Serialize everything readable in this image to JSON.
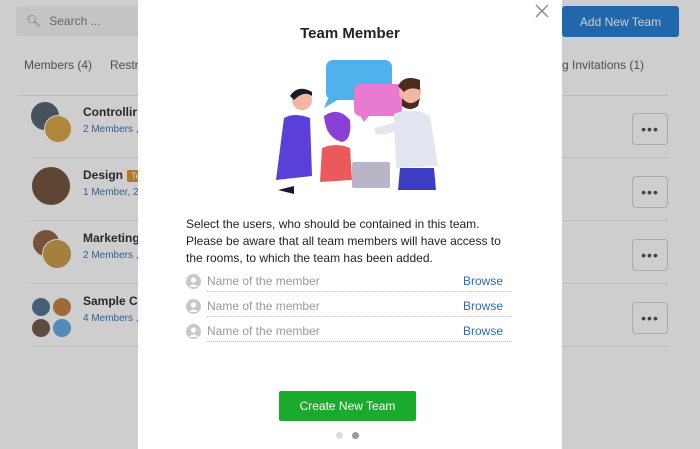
{
  "search": {
    "placeholder": "Search ..."
  },
  "header": {
    "add_team_label": "Add New Team"
  },
  "tabs": {
    "members": "Members (4)",
    "restricted": "Restr",
    "invitations": "g Invitations (1)"
  },
  "teams": [
    {
      "name": "Controllir",
      "meta": "2 Members ,",
      "tag": ""
    },
    {
      "name": "Design",
      "meta": "1 Member, 2",
      "tag": "Te"
    },
    {
      "name": "Marketing",
      "meta": "2 Members ,",
      "tag": ""
    },
    {
      "name": "Sample Co",
      "meta": "4 Members ,",
      "tag": ""
    }
  ],
  "modal": {
    "title": "Team Member",
    "description": "Select the users, who should be contained in this team. Please be aware that all team members will have access to the rooms, to which the team has been added.",
    "member_placeholder": "Name of the member",
    "browse_label": "Browse",
    "create_label": "Create New Team",
    "pager": {
      "total": 2,
      "active": 2
    }
  },
  "colors": {
    "primary_blue": "#1976d2",
    "create_green": "#1aaa2c",
    "link_blue": "#2a6db5",
    "tag_orange": "#e08a1e"
  },
  "icons": {
    "search": "search-icon",
    "close": "close-icon",
    "user": "user-placeholder-icon",
    "more": "more-dots-icon"
  }
}
